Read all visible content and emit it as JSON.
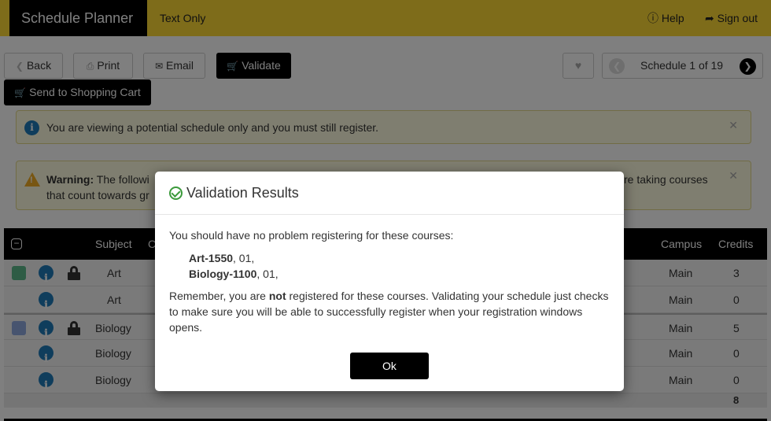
{
  "header": {
    "brand": "Schedule Planner",
    "text_only": "Text Only",
    "help": "Help",
    "sign_out": "Sign out",
    "accent_color": "#fdd835"
  },
  "toolbar": {
    "back": "Back",
    "print": "Print",
    "email": "Email",
    "validate": "Validate",
    "send_to_cart": "Send to Shopping Cart",
    "schedule_nav": "Schedule 1 of 19"
  },
  "alerts": {
    "info": "You are viewing a potential schedule only and you must still register.",
    "warning_label": "Warning:",
    "warning_line1_start": "The followi",
    "warning_line1_end": "re taking courses",
    "warning_line2": "that count towards gr"
  },
  "table": {
    "headers": {
      "subject": "Subject",
      "c": "C",
      "campus": "Campus",
      "credits": "Credits"
    },
    "rows": [
      {
        "subject": "Art",
        "campus": "Main",
        "credits": "3",
        "swatch": "#5cb98a",
        "locked": true,
        "group_start": true
      },
      {
        "subject": "Art",
        "campus": "Main",
        "credits": "0",
        "swatch": null,
        "locked": false,
        "group_start": false
      },
      {
        "subject": "Biology",
        "campus": "Main",
        "credits": "5",
        "swatch": "#8fa8de",
        "locked": true,
        "group_start": true
      },
      {
        "subject": "Biology",
        "campus": "Main",
        "credits": "0",
        "swatch": null,
        "locked": false,
        "group_start": false
      },
      {
        "subject": "Biology",
        "campus": "Main",
        "credits": "0",
        "swatch": null,
        "locked": false,
        "group_start": false
      }
    ],
    "total_credits": "8"
  },
  "modal": {
    "title": "Validation Results",
    "intro": "You should have no problem registering for these courses:",
    "courses": [
      {
        "code": "Art-1550",
        "section": ", 01,"
      },
      {
        "code": "Biology-1100",
        "section": ", 01,"
      }
    ],
    "note_before": "Remember, you are ",
    "note_bold": "not",
    "note_after": " registered for these courses. Validating your schedule just checks to make sure you will be able to successfully register when your registration windows opens.",
    "ok": "Ok"
  }
}
